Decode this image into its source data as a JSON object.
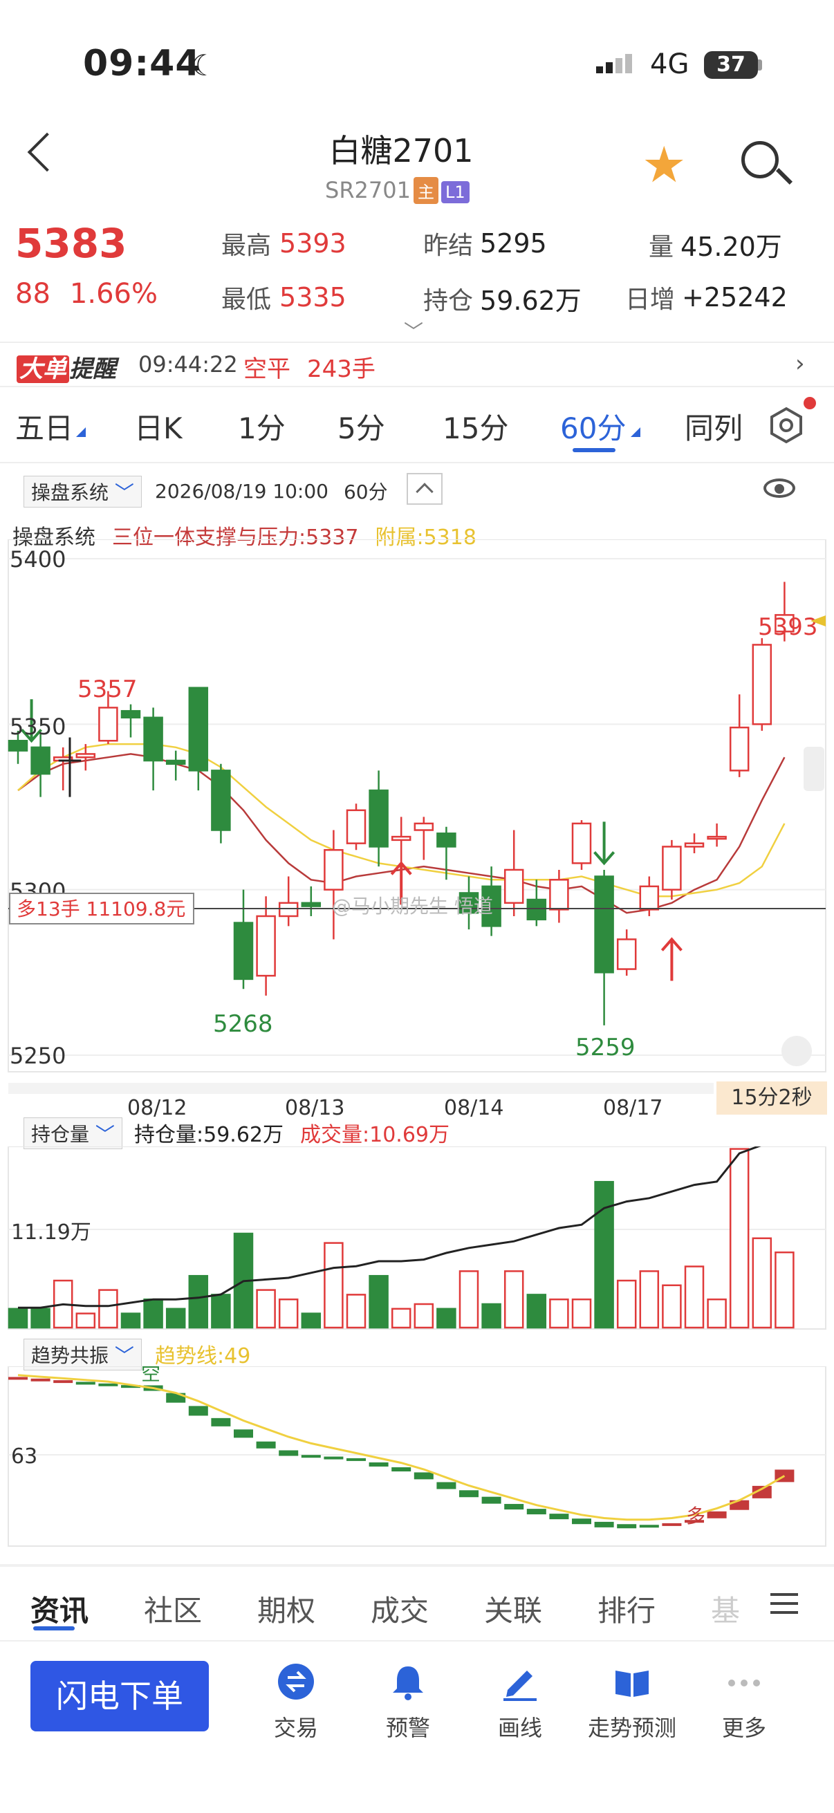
{
  "status": {
    "time": "09:44",
    "network": "4G",
    "battery": "37"
  },
  "header": {
    "title": "白糖2701",
    "code": "SR2701",
    "tag_main": "主",
    "tag_l1": "L1"
  },
  "quote": {
    "price": "5383",
    "change": "88",
    "change_pct": "1.66%",
    "high_label": "最高",
    "high": "5393",
    "low_label": "最低",
    "low": "5335",
    "settle_label": "昨结",
    "settle": "5295",
    "oi_label": "持仓",
    "oi": "59.62万",
    "vol_label": "量",
    "vol": "45.20万",
    "daily_inc_label": "日增",
    "daily_inc": "+25242"
  },
  "alert": {
    "badge1": "大单",
    "badge2": "提醒",
    "time": "09:44:22",
    "action": "空平",
    "qty": "243手"
  },
  "period_tabs": [
    "五日",
    "日K",
    "1分",
    "5分",
    "15分",
    "60分",
    "同列"
  ],
  "chart_panel": {
    "selector": "操盘系统",
    "datetime": "2026/08/19 10:00",
    "period": "60分",
    "indicator_name": "操盘系统",
    "indicator_main": "三位一体支撑与压力:5337",
    "indicator_sub": "附属:5318",
    "position_label": "多13手 11109.8元",
    "timer": "15分2秒",
    "watermark": "@马小期先生 悟道"
  },
  "colors": {
    "up": "#e03a3a",
    "down": "#2e8b3e",
    "accent": "#2c63d8",
    "ma_red": "#b83a3a",
    "ma_yellow": "#f0d040"
  },
  "chart_data": [
    {
      "type": "candlestick",
      "y_ticks": [
        "5400",
        "5350",
        "5300",
        "5250"
      ],
      "ylim": [
        5250,
        5400
      ],
      "x_labels": [
        "08/12",
        "08/13",
        "08/14",
        "08/17"
      ],
      "annotations": {
        "high_left": "5357",
        "high_right": "5393",
        "low_1": "5268",
        "low_2": "5259"
      },
      "candles": [
        [
          5345,
          5342,
          5348,
          5338
        ],
        [
          5343,
          5335,
          5347,
          5328
        ],
        [
          5339,
          5340,
          5343,
          5330
        ],
        [
          5340,
          5341,
          5344,
          5336
        ],
        [
          5345,
          5355,
          5360,
          5344
        ],
        [
          5354,
          5352,
          5356,
          5346
        ],
        [
          5352,
          5339,
          5355,
          5330
        ],
        [
          5339,
          5338,
          5342,
          5333
        ],
        [
          5361,
          5336,
          5361,
          5330
        ],
        [
          5336,
          5318,
          5338,
          5314
        ],
        [
          5290,
          5273,
          5300,
          5270
        ],
        [
          5274,
          5292,
          5298,
          5268
        ],
        [
          5292,
          5296,
          5304,
          5289
        ],
        [
          5296,
          5295,
          5301,
          5292
        ],
        [
          5300,
          5312,
          5318,
          5285
        ],
        [
          5314,
          5324,
          5326,
          5312
        ],
        [
          5330,
          5313,
          5336,
          5307
        ],
        [
          5315,
          5316,
          5322,
          5308
        ],
        [
          5318,
          5320,
          5322,
          5309
        ],
        [
          5317,
          5313,
          5319,
          5303
        ],
        [
          5299,
          5293,
          5304,
          5288
        ],
        [
          5301,
          5289,
          5307,
          5286
        ],
        [
          5296,
          5306,
          5318,
          5292
        ],
        [
          5297,
          5291,
          5303,
          5289
        ],
        [
          5294,
          5303,
          5306,
          5290
        ],
        [
          5308,
          5320,
          5321,
          5306
        ],
        [
          5304,
          5275,
          5306,
          5259
        ],
        [
          5276,
          5285,
          5288,
          5274
        ],
        [
          5294,
          5301,
          5304,
          5292
        ],
        [
          5300,
          5313,
          5315,
          5297
        ],
        [
          5313,
          5314,
          5317,
          5311
        ],
        [
          5316,
          5316,
          5320,
          5313
        ],
        [
          5336,
          5349,
          5359,
          5334
        ],
        [
          5350,
          5374,
          5376,
          5348
        ],
        [
          5378,
          5383,
          5393,
          5375
        ]
      ],
      "ma_red": [
        5330,
        5335,
        5338,
        5339,
        5340,
        5341,
        5340,
        5338,
        5336,
        5331,
        5324,
        5315,
        5308,
        5303,
        5302,
        5304,
        5305,
        5306,
        5307,
        5306,
        5305,
        5304,
        5303,
        5301,
        5300,
        5301,
        5297,
        5293,
        5294,
        5296,
        5300,
        5303,
        5313,
        5327,
        5340
      ],
      "ma_yellow": [
        5330,
        5336,
        5340,
        5343,
        5344,
        5344,
        5344,
        5343,
        5341,
        5337,
        5331,
        5325,
        5320,
        5315,
        5312,
        5310,
        5308,
        5307,
        5306,
        5305,
        5304,
        5303,
        5303,
        5303,
        5303,
        5304,
        5302,
        5300,
        5298,
        5298,
        5299,
        5300,
        5302,
        5307,
        5320
      ]
    },
    {
      "type": "bar",
      "selector": "持仓量",
      "series_oi_label": "持仓量:59.62万",
      "series_vol_label": "成交量:10.69万",
      "y_tick": "11.19万",
      "volume": [
        0.2,
        0.2,
        0.5,
        0.15,
        0.4,
        0.15,
        0.3,
        0.2,
        0.55,
        0.35,
        1.0,
        0.4,
        0.3,
        0.15,
        0.9,
        0.35,
        0.55,
        0.2,
        0.25,
        0.2,
        0.6,
        0.25,
        0.6,
        0.35,
        0.3,
        0.3,
        1.55,
        0.5,
        0.6,
        0.45,
        0.65,
        0.3,
        1.9,
        0.95,
        0.8
      ],
      "up": [
        false,
        false,
        true,
        true,
        true,
        false,
        false,
        false,
        false,
        false,
        false,
        true,
        true,
        false,
        true,
        true,
        false,
        true,
        true,
        false,
        true,
        false,
        true,
        false,
        true,
        true,
        false,
        true,
        true,
        true,
        true,
        true,
        true,
        true,
        true
      ],
      "oi_line": [
        0.12,
        0.12,
        0.14,
        0.13,
        0.13,
        0.15,
        0.17,
        0.17,
        0.18,
        0.2,
        0.28,
        0.29,
        0.3,
        0.33,
        0.36,
        0.37,
        0.4,
        0.4,
        0.41,
        0.45,
        0.48,
        0.5,
        0.52,
        0.56,
        0.6,
        0.62,
        0.72,
        0.76,
        0.78,
        0.82,
        0.86,
        0.88,
        1.05,
        1.1,
        1.1
      ]
    },
    {
      "type": "bar",
      "selector": "趋势共振",
      "series_label": "趋势线:49",
      "y_tick": "63",
      "labels": {
        "kong": "空",
        "duo": "多"
      }
    }
  ],
  "bottom_tabs": [
    "资讯",
    "社区",
    "期权",
    "成交",
    "关联",
    "排行",
    "基"
  ],
  "bottom_bar": {
    "order_button": "闪电下单",
    "items": [
      "交易",
      "预警",
      "画线",
      "走势预测",
      "更多"
    ]
  }
}
